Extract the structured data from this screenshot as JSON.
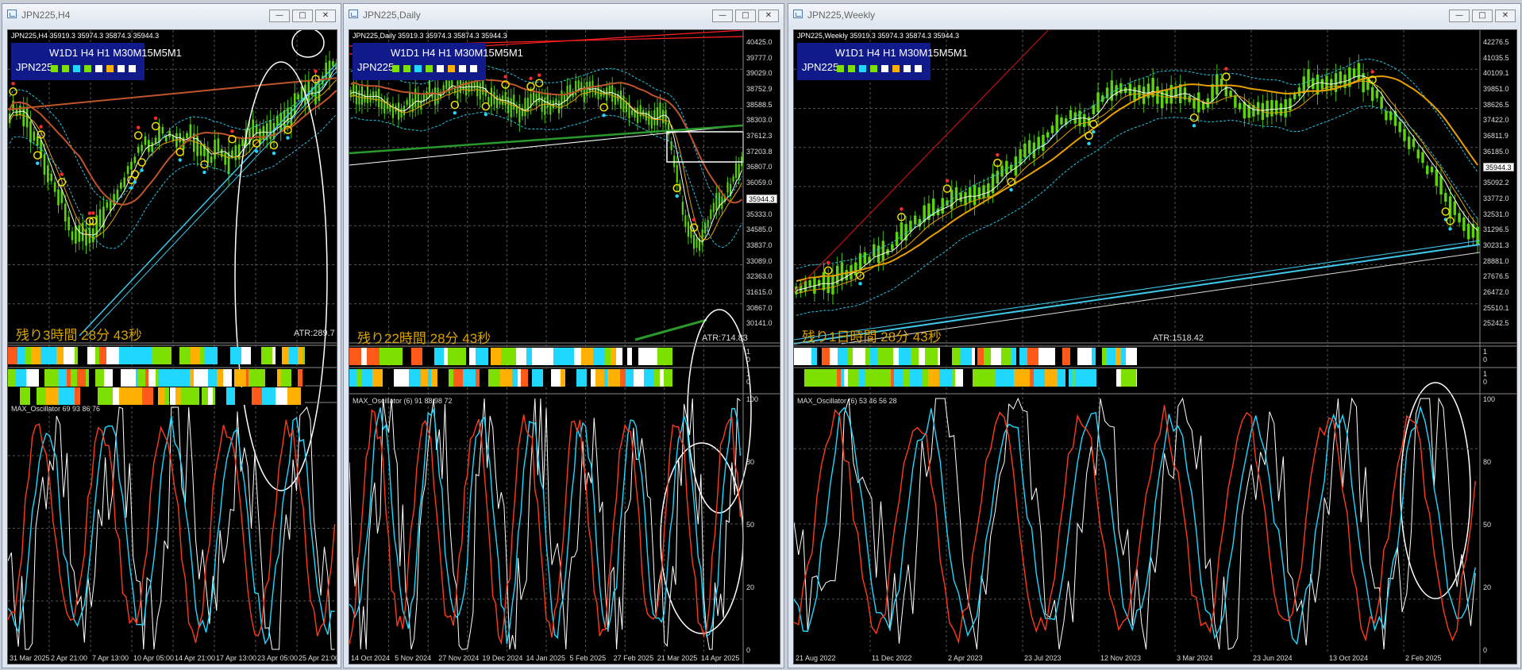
{
  "windows": [
    {
      "title": "JPN225,H4",
      "info": "JPN225,H4  35919.3 35974.3 35874.3 35944.3",
      "tf_row": "W1D1 H4 H1 M30M15M5M1",
      "symbol": "JPN225",
      "countdown": "残り3時間 28分 43秒",
      "atr": "ATR:289.7",
      "panels": [
        "W1",
        "D1"
      ],
      "oscillator": "MAX_Oscillator 69 93 86 76",
      "price_labels": [],
      "osc_labels": [],
      "dates": [
        "31 Mar 2025",
        "2 Apr 21:00",
        "7 Apr 13:00",
        "10 Apr 05:00",
        "14 Apr 21:00",
        "17 Apr 13:00",
        "23 Apr 05:00",
        "25 Apr 21:00"
      ]
    },
    {
      "title": "JPN225,Daily",
      "info": "JPN225,Daily  35919.3 35974.3 35874.3 35944.3",
      "tf_row": "W1D1 H4 H1 M30M15M5M1",
      "symbol": "JPN225",
      "countdown": "残り22時間 28分 43秒",
      "atr": "ATR:714.83",
      "panels": [
        "W1",
        ""
      ],
      "oscillator": "MAX_Oscillator (6) 91 88 98 72",
      "price_labels": [
        "40425.0",
        "39777.0",
        "39029.0",
        "38752.9",
        "38588.5",
        "38303.0",
        "37612.3",
        "37203.8",
        "36807.0",
        "36059.0",
        "35944.3",
        "35333.0",
        "34585.0",
        "33837.0",
        "33089.0",
        "32363.0",
        "31615.0",
        "30867.0",
        "30141.0"
      ],
      "panel_ticks": [
        "1",
        "0",
        "1",
        "0"
      ],
      "osc_labels": [
        "100",
        "80",
        "50",
        "20",
        "0"
      ],
      "dates": [
        "14 Oct 2024",
        "5 Nov 2024",
        "27 Nov 2024",
        "19 Dec 2024",
        "14 Jan 2025",
        "5 Feb 2025",
        "27 Feb 2025",
        "21 Mar 2025",
        "14 Apr 2025"
      ]
    },
    {
      "title": "JPN225,Weekly",
      "info": "JPN225,Weekly  35919.3 35974.3 35874.3 35944.3",
      "tf_row": "W1D1 H4 H1 M30M15M5M1",
      "symbol": "JPN225",
      "countdown": "残り1日時間 28分 43秒",
      "atr": "ATR:1518.42",
      "panels": [
        "W1",
        ""
      ],
      "oscillator": "MAX_Oscillator (6) 53 46 56 28",
      "price_labels": [
        "42276.5",
        "41035.5",
        "40109.1",
        "39851.0",
        "38626.5",
        "37422.0",
        "36811.9",
        "36185.0",
        "35944.3",
        "35092.2",
        "33772.0",
        "32531.0",
        "31296.5",
        "30231.3",
        "28881.0",
        "27676.5",
        "26472.0",
        "25510.1",
        "25242.5"
      ],
      "panel_ticks": [
        "1",
        "0",
        "1",
        "0"
      ],
      "osc_labels": [
        "100",
        "80",
        "50",
        "20",
        "0"
      ],
      "dates": [
        "21 Aug 2022",
        "11 Dec 2022",
        "2 Apr 2023",
        "23 Jul 2023",
        "12 Nov 2023",
        "3 Mar 2024",
        "23 Jun 2024",
        "13 Oct 2024",
        "2 Feb 2025"
      ]
    }
  ],
  "buttons": {
    "minimize": "—",
    "maximize": "□",
    "close": "✕"
  },
  "colors": {
    "up_candle": "#5bd40c",
    "tf_panel": "#111a8a",
    "countdown": "#d9a200",
    "trendline": "#3fc8e8"
  }
}
